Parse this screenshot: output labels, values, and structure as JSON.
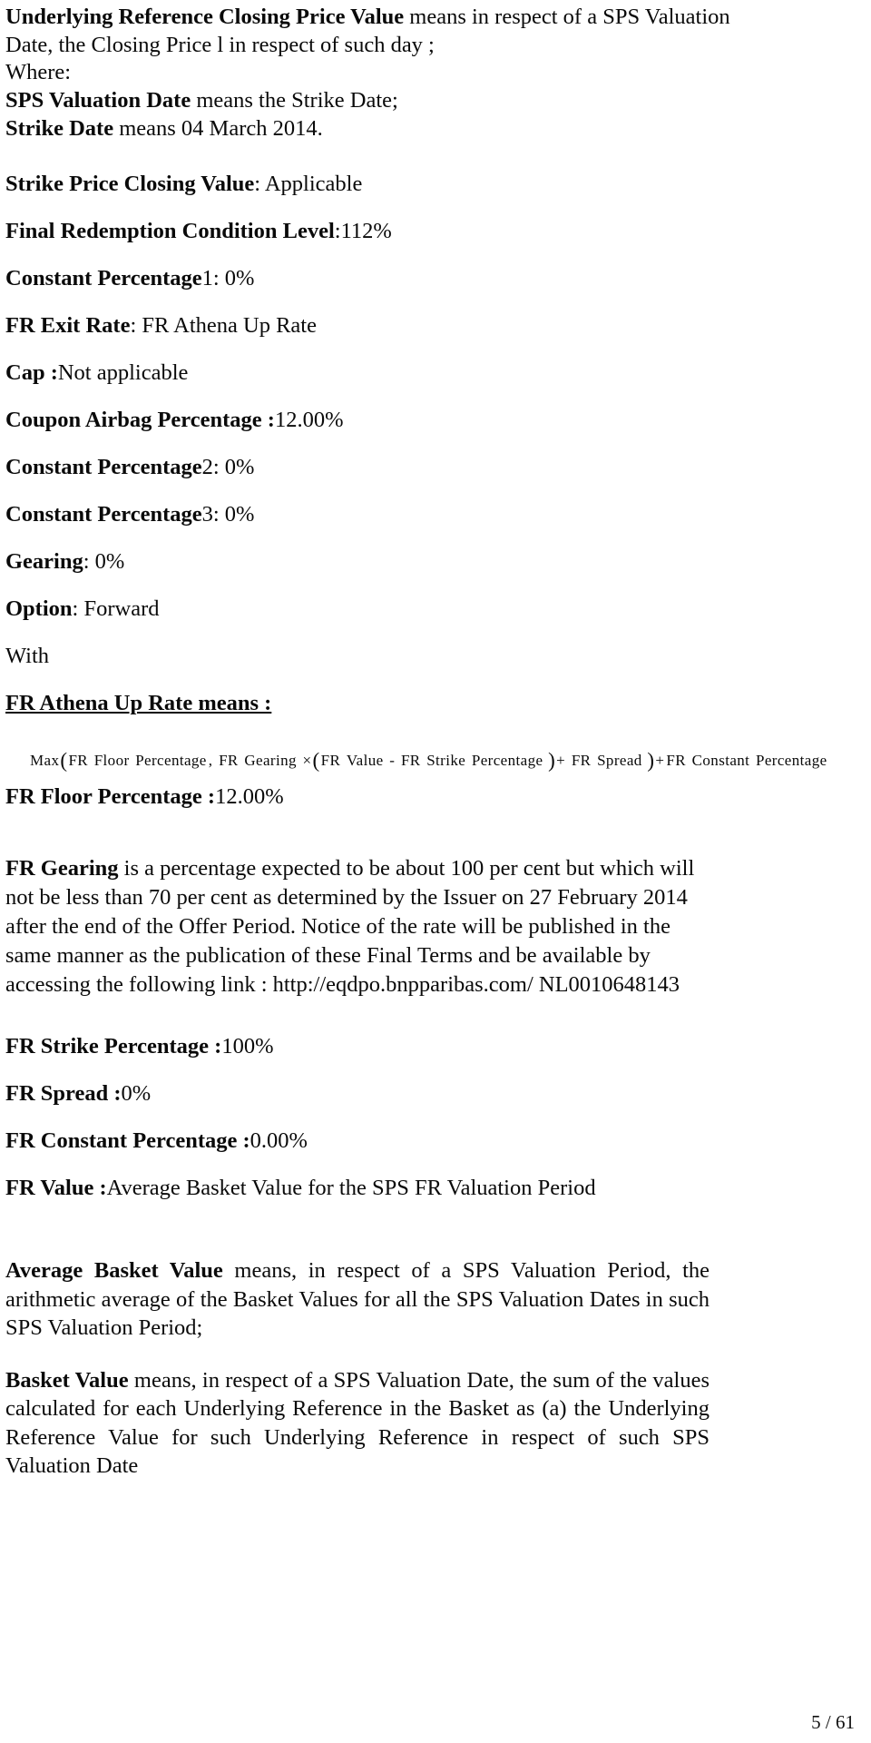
{
  "document": {
    "page_number": "5 / 61",
    "intro": {
      "line1_bold": "Underlying Reference Closing Price Value",
      "line1_rest": " means in respect of a SPS Valuation",
      "line2": "Date, the Closing Price l in respect of such day ;",
      "line3": "Where:",
      "line4_bold": "SPS Valuation Date",
      "line4_rest": " means the Strike Date;",
      "line5_bold": "Strike Date",
      "line5_rest": " means 04 March 2014."
    },
    "terms": [
      {
        "label": "Strike Price Closing Value",
        "value": " : Applicable"
      },
      {
        "label": "Final Redemption Condition Level",
        "value": ":112%"
      },
      {
        "label": "Constant Percentage",
        "value": " 1: 0%"
      },
      {
        "label": "FR Exit Rate",
        "value": " : FR Athena Up Rate"
      },
      {
        "label": "Cap :",
        "value": " Not applicable"
      },
      {
        "label": "Coupon Airbag Percentage :",
        "value": " 12.00%"
      },
      {
        "label": "Constant Percentage",
        "value": " 2: 0%"
      },
      {
        "label": "Constant Percentage",
        "value": " 3: 0%"
      },
      {
        "label": "Gearing",
        "value": ": 0%"
      },
      {
        "label": "Option",
        "value": ": Forward"
      }
    ],
    "with_label": "With",
    "athena_heading": "FR Athena Up Rate means :",
    "formula": {
      "full_text": "Max(FR Floor Percentage , FR Gearing ×(FR Value - FR Strike Percentage )+ FR Spread )+FR Constant Percentage",
      "tokens": [
        "Max",
        "(",
        "FR",
        "Floor",
        "Percentage",
        ",",
        "FR",
        "Gearing",
        "×",
        "(",
        "FR",
        "Value",
        "-",
        "FR",
        "Strike",
        "Percentage",
        ")",
        "+",
        "FR",
        "Spread",
        ")",
        "+",
        "FR",
        "Constant",
        "Percentage"
      ]
    },
    "floor_percentage": {
      "label": "FR Floor Percentage : ",
      "value": "12.00%"
    },
    "fr_gearing": {
      "label": "FR Gearing",
      "text": " is a percentage expected to be about 100 per cent but which will not be less than 70 per cent as determined by the Issuer on 27 February 2014 after the end of the Offer Period. Notice of the rate will be published in the same manner as the publication of these Final Terms and be available by accessing the following link : http://eqdpo.bnpparibas.com/ NL0010648143"
    },
    "terms2": [
      {
        "label": "FR Strike Percentage :",
        "value": " 100%"
      },
      {
        "label": "FR Spread :",
        "value": " 0%"
      },
      {
        "label": "FR Constant Percentage :",
        "value": " 0.00%"
      },
      {
        "label": "FR Value :",
        "value": " Average Basket Value for the SPS FR Valuation Period"
      }
    ],
    "average_basket_value": {
      "label": "Average Basket Value",
      "text": " means, in respect of a SPS Valuation Period, the arithmetic average of the Basket Values for all the SPS  Valuation Dates in such SPS Valuation Period;"
    },
    "basket_value": {
      "label": "Basket Value",
      "text": " means, in respect of a SPS Valuation Date, the sum of the values calculated for each Underlying Reference in the Basket as (a) the Underlying Reference Value for such Underlying Reference in respect of such SPS Valuation Date"
    }
  }
}
